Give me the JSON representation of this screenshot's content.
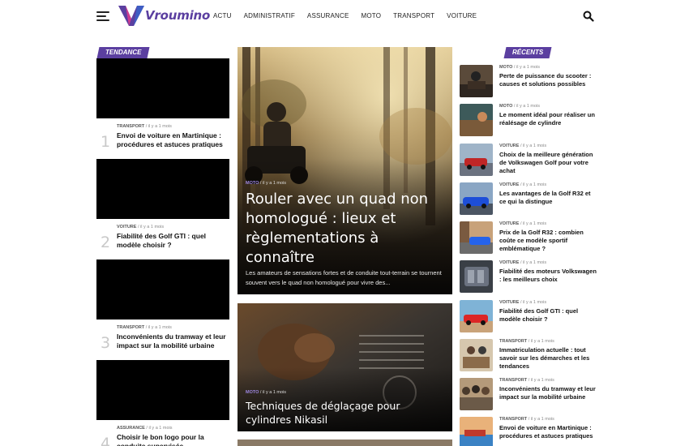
{
  "header": {
    "logo_text": "Vroumino",
    "nav": [
      "ACTU",
      "ADMINISTRATIF",
      "ASSURANCE",
      "MOTO",
      "TRANSPORT",
      "VOITURE"
    ]
  },
  "colors": {
    "accent": "#5b3fa0",
    "tag_bg": "#5b3fa0"
  },
  "tendance": {
    "label": "TENDANCE",
    "items": [
      {
        "num": "1",
        "category": "TRANSPORT",
        "date": "il y a 1 mois",
        "title": "Envoi de voiture en Martinique : procédures et astuces pratiques"
      },
      {
        "num": "2",
        "category": "VOITURE",
        "date": "il y a 1 mois",
        "title": "Fiabilité des Golf GTI : quel modèle choisir ?"
      },
      {
        "num": "3",
        "category": "TRANSPORT",
        "date": "il y a 1 mois",
        "title": "Inconvénients du tramway et leur impact sur la mobilité urbaine"
      },
      {
        "num": "4",
        "category": "ASSURANCE",
        "date": "il y a 1 mois",
        "title": "Choisir le bon logo pour la conduite supervisée"
      }
    ]
  },
  "featured": [
    {
      "category": "MOTO",
      "date": "il y a 1 mois",
      "title": "Rouler avec un quad non homologué : lieux et règlementations à connaître",
      "excerpt": "Les amateurs de sensations fortes et de conduite tout-terrain se tournent souvent vers le quad non homologué pour vivre des..."
    },
    {
      "category": "MOTO",
      "date": "il y a 1 mois",
      "title": "Techniques de déglaçage pour cylindres Nikasil"
    }
  ],
  "recents": {
    "label": "RÉCENTS",
    "items": [
      {
        "category": "MOTO",
        "date": "il y a 1 mois",
        "title": "Perte de puissance du scooter : causes et solutions possibles",
        "thumb": "moto-rider"
      },
      {
        "category": "MOTO",
        "date": "il y a 1 mois",
        "title": "Le moment idéal pour réaliser un réalésage de cylindre",
        "thumb": "mechanic-shop"
      },
      {
        "category": "VOITURE",
        "date": "il y a 1 mois",
        "title": "Choix de la meilleure génération de Volkswagen Golf pour votre achat",
        "thumb": "car-showroom"
      },
      {
        "category": "VOITURE",
        "date": "il y a 1 mois",
        "title": "Les avantages de la Golf R32 et ce qui la distingue",
        "thumb": "blue-car"
      },
      {
        "category": "VOITURE",
        "date": "il y a 1 mois",
        "title": "Prix de la Golf R32 : combien coûte ce modèle sportif emblématique ?",
        "thumb": "street-car"
      },
      {
        "category": "VOITURE",
        "date": "il y a 1 mois",
        "title": "Fiabilité des moteurs Volkswagen : les meilleurs choix",
        "thumb": "engine"
      },
      {
        "category": "VOITURE",
        "date": "il y a 1 mois",
        "title": "Fiabilité des Golf GTI : quel modèle choisir ?",
        "thumb": "red-car"
      },
      {
        "category": "TRANSPORT",
        "date": "il y a 1 mois",
        "title": "Immatriculation actuelle : tout savoir sur les démarches et les tendances",
        "thumb": "office"
      },
      {
        "category": "TRANSPORT",
        "date": "il y a 1 mois",
        "title": "Inconvénients du tramway et leur impact sur la mobilité urbaine",
        "thumb": "crowd"
      },
      {
        "category": "TRANSPORT",
        "date": "il y a 1 mois",
        "title": "Envoi de voiture en Martinique : procédures et astuces pratiques",
        "thumb": "harbor"
      }
    ]
  }
}
